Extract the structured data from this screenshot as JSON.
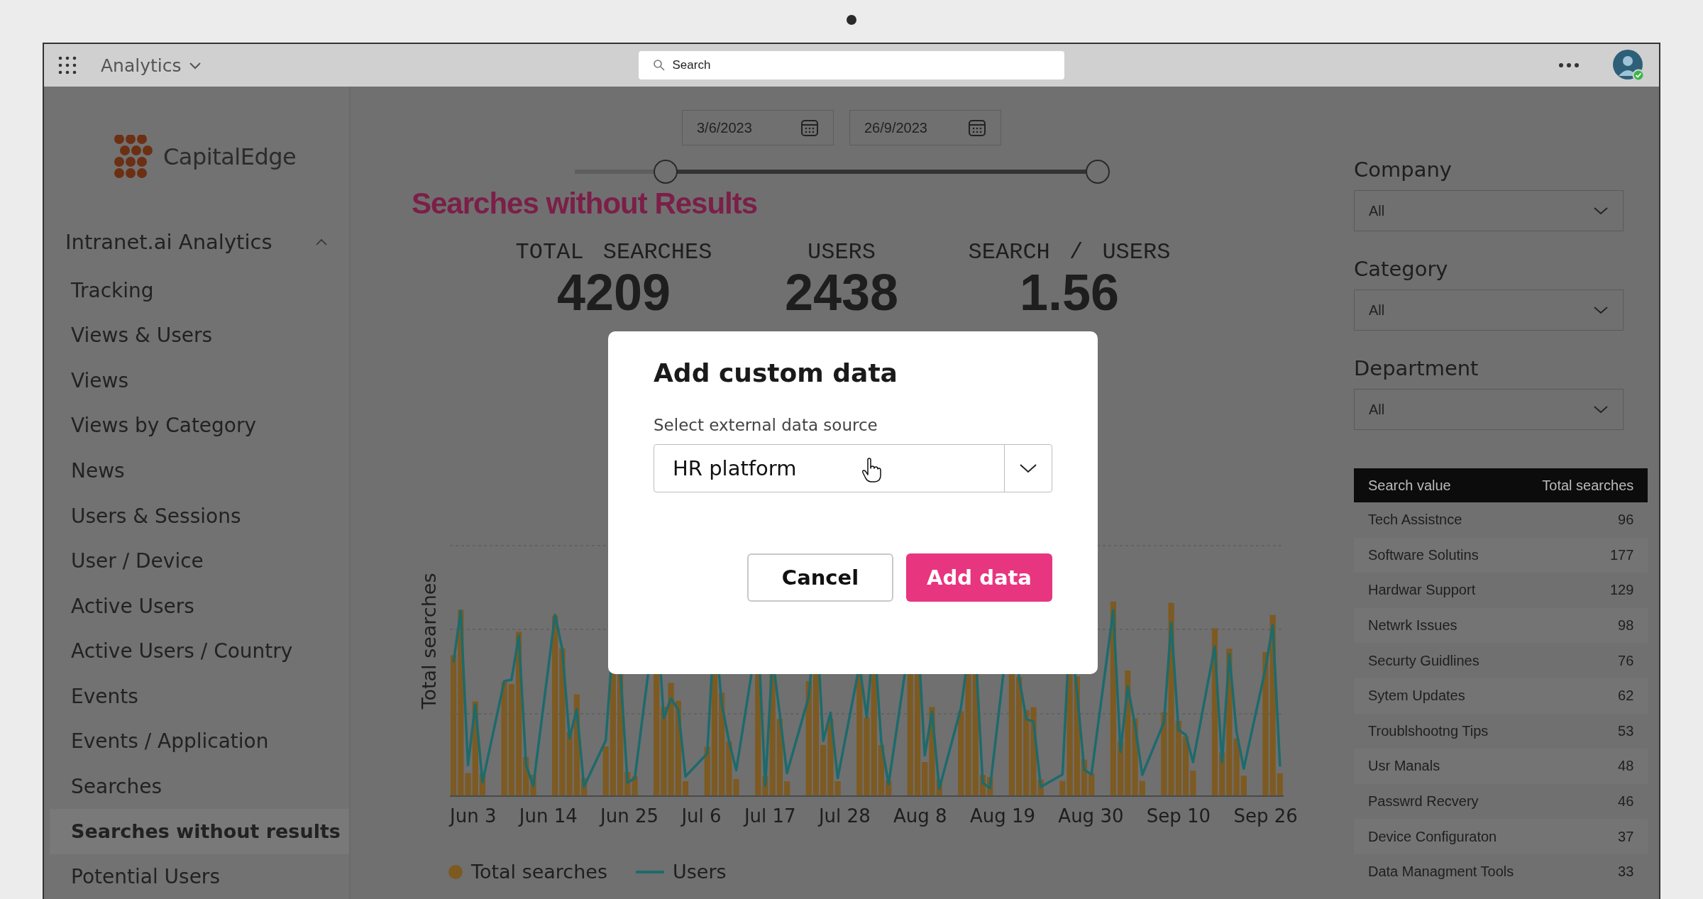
{
  "topbar": {
    "app": "Analytics",
    "search": {
      "placeholder": "Search"
    }
  },
  "sidebar": {
    "logo": "CapitalEdge",
    "section": {
      "label": "Intranet.ai Analytics",
      "expanded": true
    },
    "items": [
      {
        "label": "Tracking",
        "selected": false
      },
      {
        "label": "Views & Users",
        "selected": false
      },
      {
        "label": "Views",
        "selected": false
      },
      {
        "label": "Views by Category",
        "selected": false
      },
      {
        "label": "News",
        "selected": false
      },
      {
        "label": "Users & Sessions",
        "selected": false
      },
      {
        "label": "User / Device",
        "selected": false
      },
      {
        "label": "Active Users",
        "selected": false
      },
      {
        "label": "Active Users / Country",
        "selected": false
      },
      {
        "label": "Events",
        "selected": false
      },
      {
        "label": "Events / Application",
        "selected": false
      },
      {
        "label": "Searches",
        "selected": false
      },
      {
        "label": "Searches without results",
        "selected": true
      },
      {
        "label": "Potential Users",
        "selected": false
      }
    ]
  },
  "date_range": {
    "start": "3/6/2023",
    "end": "26/9/2023",
    "from": {
      "level": 0.17
    },
    "to": {
      "level": 0.98
    }
  },
  "page_title": "Searches without Results",
  "stats": [
    {
      "label": "TOTAL SEARCHES",
      "value": "4209"
    },
    {
      "label": "USERS",
      "value": "2438"
    },
    {
      "label": "SEARCH / USERS",
      "value": "1.56"
    }
  ],
  "chart": {
    "ylabel": "Total searches",
    "xlabels": [
      "Jun 3",
      "Jun 14",
      "Jun 25",
      "Jul 6",
      "Jul 17",
      "Jul 28",
      "Aug 8",
      "Aug 19",
      "Aug 30",
      "Sep 10",
      "Sep 26"
    ],
    "legend": [
      {
        "name": "Total searches",
        "kind": "dot",
        "color": "#7d5a22"
      },
      {
        "name": "Users",
        "kind": "line",
        "color": "#1d6a6c"
      }
    ]
  },
  "filters": [
    {
      "label": "Company",
      "value": "All"
    },
    {
      "label": "Category",
      "value": "All"
    },
    {
      "label": "Department",
      "value": "All"
    }
  ],
  "table": {
    "columns": [
      "Search value",
      "Total searches"
    ],
    "rows": [
      [
        "Tech Assistnce",
        "96"
      ],
      [
        "Software Solutins",
        "177"
      ],
      [
        "Hardwar Support",
        "129"
      ],
      [
        "Netwrk Issues",
        "98"
      ],
      [
        "Securty Guidlines",
        "76"
      ],
      [
        "Sytem Updates",
        "62"
      ],
      [
        "Troublshootng Tips",
        "53"
      ],
      [
        "Usr Manals",
        "48"
      ],
      [
        "Passwrd Recvery",
        "46"
      ],
      [
        "Device Configuraton",
        "37"
      ],
      [
        "Data Managment Tools",
        "33"
      ]
    ]
  },
  "modal": {
    "title": "Add custom data",
    "field_label": "Select external data source",
    "value": "HR platform",
    "buttons": [
      {
        "label": "Cancel",
        "kind": "secondary"
      },
      {
        "label": "Add data",
        "kind": "primary"
      }
    ]
  }
}
